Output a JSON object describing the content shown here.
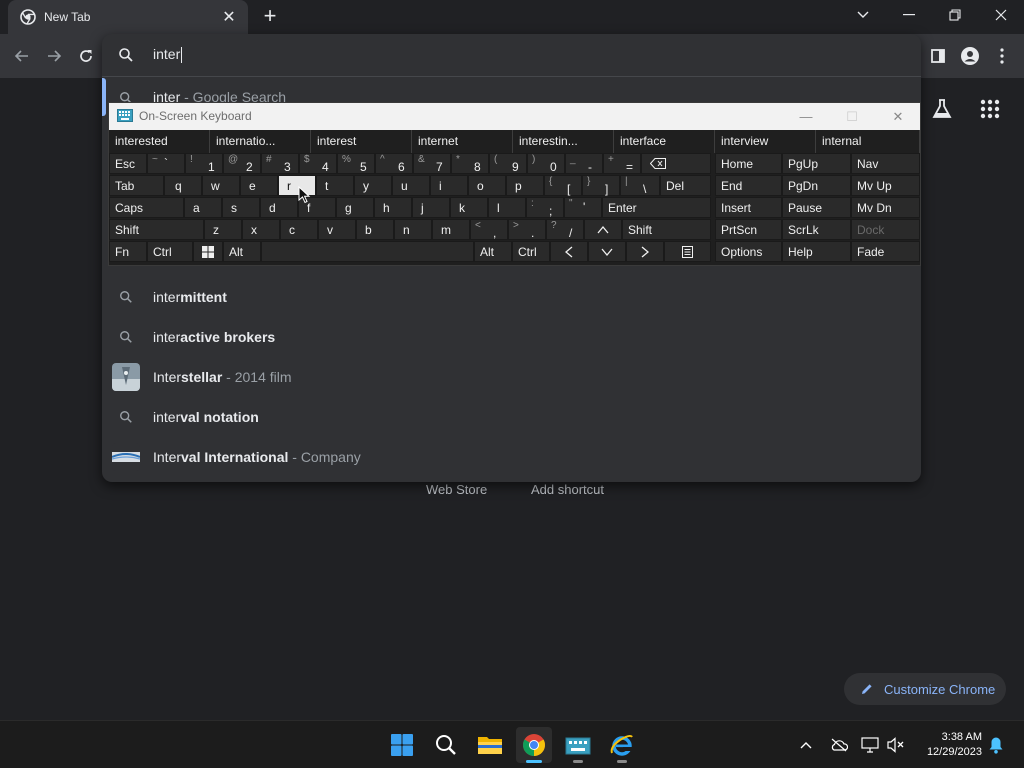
{
  "tab": {
    "title": "New Tab"
  },
  "omnibox": {
    "query": "inter",
    "suggestions": [
      {
        "typed": "inter",
        "completion": "",
        "desc": " - Google Search",
        "kind": "search"
      },
      {
        "typed": "inter",
        "completion": "mittent",
        "desc": "",
        "kind": "search"
      },
      {
        "typed": "inter",
        "completion": "active brokers",
        "desc": "",
        "kind": "search"
      },
      {
        "typed": "Inter",
        "completion": "stellar",
        "desc": " - 2014 film",
        "kind": "entity"
      },
      {
        "typed": "inter",
        "completion": "val notation",
        "desc": "",
        "kind": "search"
      },
      {
        "typed": "Inter",
        "completion": "val International",
        "desc": " - Company",
        "kind": "entity"
      }
    ]
  },
  "page": {
    "shortcuts": [
      "Web Store",
      "Add shortcut"
    ],
    "customize_label": "Customize Chrome"
  },
  "osk": {
    "title": "On-Screen Keyboard",
    "predictions": [
      "interested",
      "internatio...",
      "interest",
      "internet",
      "interestin...",
      "interface",
      "interview",
      "internal"
    ],
    "keys": {
      "esc": "Esc",
      "tab": "Tab",
      "caps": "Caps",
      "shift": "Shift",
      "fn": "Fn",
      "ctrl": "Ctrl",
      "alt": "Alt",
      "del": "Del",
      "enter": "Enter",
      "shift_r": "Shift",
      "alt_r": "Alt",
      "ctrl_r": "Ctrl",
      "home": "Home",
      "pgup": "PgUp",
      "nav": "Nav",
      "end": "End",
      "pgdn": "PgDn",
      "mvup": "Mv Up",
      "insert": "Insert",
      "pause": "Pause",
      "mvdn": "Mv Dn",
      "prtscn": "PrtScn",
      "scrlk": "ScrLk",
      "dock": "Dock",
      "options": "Options",
      "help": "Help",
      "fade": "Fade",
      "row1": [
        {
          "sh": "~",
          "mn": "`"
        },
        {
          "sh": "!",
          "mn": "1"
        },
        {
          "sh": "@",
          "mn": "2"
        },
        {
          "sh": "#",
          "mn": "3"
        },
        {
          "sh": "$",
          "mn": "4"
        },
        {
          "sh": "%",
          "mn": "5"
        },
        {
          "sh": "^",
          "mn": "6"
        },
        {
          "sh": "&",
          "mn": "7"
        },
        {
          "sh": "*",
          "mn": "8"
        },
        {
          "sh": "(",
          "mn": "9"
        },
        {
          "sh": ")",
          "mn": "0"
        },
        {
          "sh": "_",
          "mn": "-"
        },
        {
          "sh": "+",
          "mn": "="
        }
      ],
      "row2": [
        "q",
        "w",
        "e",
        "r",
        "t",
        "y",
        "u",
        "i",
        "o",
        "p"
      ],
      "row2_br": [
        {
          "sh": "{",
          "mn": "["
        },
        {
          "sh": "}",
          "mn": "]"
        },
        {
          "sh": "|",
          "mn": "\\"
        }
      ],
      "row3": [
        "a",
        "s",
        "d",
        "f",
        "g",
        "h",
        "j",
        "k",
        "l"
      ],
      "row3_p": [
        {
          "sh": ":",
          "mn": ";"
        },
        {
          "sh": "\"",
          "mn": "'"
        }
      ],
      "row4": [
        "z",
        "x",
        "c",
        "v",
        "b",
        "n",
        "m"
      ],
      "row4_p": [
        {
          "sh": "<",
          "mn": ","
        },
        {
          "sh": ">",
          "mn": "."
        },
        {
          "sh": "?",
          "mn": "/"
        }
      ]
    },
    "pressed_key": "r"
  },
  "taskbar": {
    "time": "3:38 AM",
    "date": "12/29/2023"
  },
  "colors": {
    "accent": "#8ab4f8",
    "taskbar_active": "#4cc2ff"
  }
}
